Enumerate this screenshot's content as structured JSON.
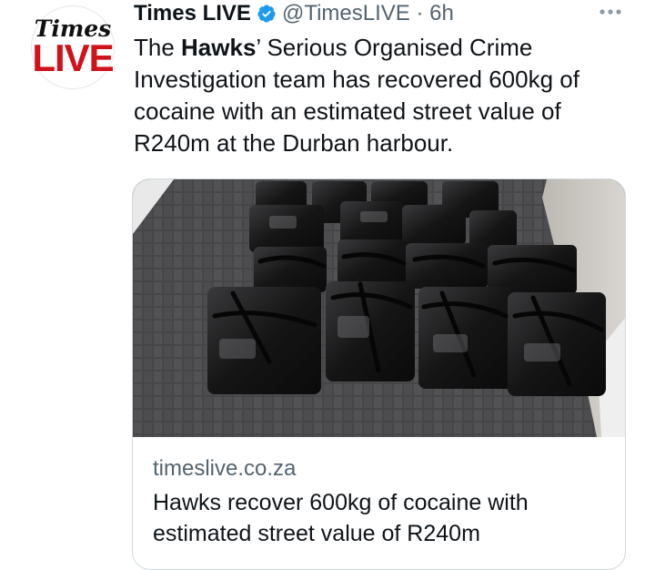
{
  "tweet": {
    "avatar": {
      "line1": "Times",
      "line2": "LIVE"
    },
    "author_name": "Times LIVE",
    "handle_time": "@TimesLIVE · 6h",
    "text_prefix": "The ",
    "text_bold": "Hawks",
    "text_rest": "’ Serious Organised Crime Investigation team has recovered 600kg of cocaine with an estimated street value of R240m at the Durban harbour.",
    "more_icon": "more-horizontal-icon",
    "verified_icon": "verified-badge-icon"
  },
  "card": {
    "domain": "timeslive.co.za",
    "title": "Hawks recover 600kg of cocaine with estimated street value of R240m"
  },
  "colors": {
    "text_primary": "#0f1419",
    "text_secondary": "#536471",
    "verified": "#1d9bf0",
    "avatar_red": "#d0121b",
    "card_border": "#cfd9de"
  }
}
